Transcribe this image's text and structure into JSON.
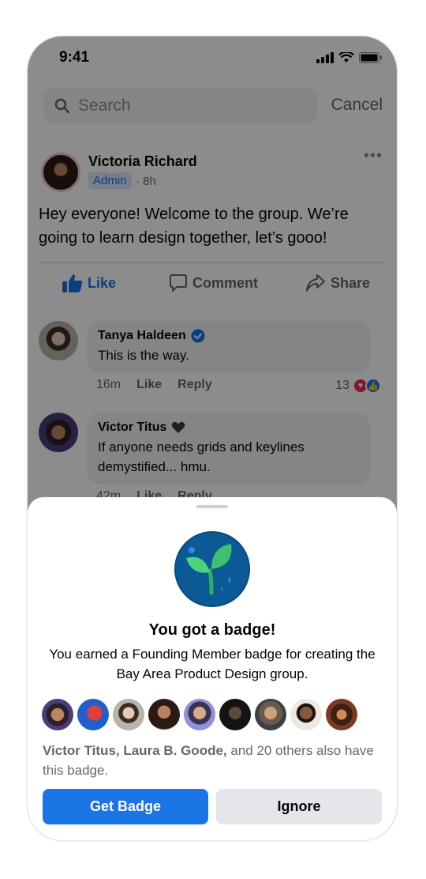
{
  "status_bar": {
    "time": "9:41"
  },
  "search": {
    "placeholder": "Search",
    "cancel_label": "Cancel"
  },
  "post": {
    "author": "Victoria Richard",
    "role_badge": "Admin",
    "time": "· 8h",
    "text": "Hey everyone! Welcome to the group. We’re going to learn design together, let’s gooo!",
    "actions": {
      "like": "Like",
      "comment": "Comment",
      "share": "Share"
    }
  },
  "comments": [
    {
      "author": "Tanya Haldeen",
      "text": "This is the way.",
      "time": "16m",
      "like": "Like",
      "reply": "Reply",
      "reaction_count": "13"
    },
    {
      "author": "Victor Titus",
      "text": "If anyone needs grids and keylines demystified... hmu.",
      "time": "42m",
      "like": "Like",
      "reply": "Reply"
    }
  ],
  "sheet": {
    "title": "You got a badge!",
    "description": "You earned a Founding Member badge for creating the Bay Area Product Design group.",
    "others_names": "Victor Titus, Laura B. Goode,",
    "others_rest": " and 20 others also have this badge.",
    "primary_button": "Get Badge",
    "secondary_button": "Ignore"
  },
  "colors": {
    "accent": "#1b74e4",
    "overlay": "rgba(0,0,0,0.45)",
    "badge_bg": "#0b5a96",
    "badge_leaf": "#4cd37b"
  }
}
